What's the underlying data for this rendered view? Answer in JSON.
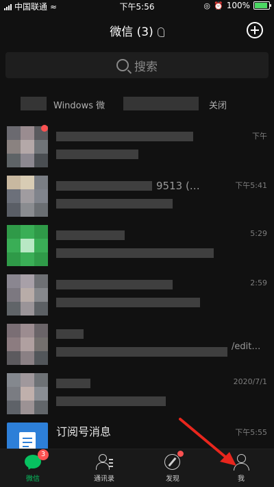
{
  "status_bar": {
    "carrier": "中国联通",
    "time": "下午5:56",
    "battery": "100%"
  },
  "nav": {
    "title": "微信 (3)"
  },
  "search": {
    "placeholder": "搜索"
  },
  "notice": {
    "text": "Windows 微",
    "close_label": "关闭"
  },
  "chats": [
    {
      "time": "下午",
      "sub": ""
    },
    {
      "time": "下午5:41",
      "sub": "9513  (…"
    },
    {
      "time": "5:29",
      "sub": ""
    },
    {
      "time": "2:59",
      "sub": ""
    },
    {
      "time": "",
      "sub": "/edit…"
    },
    {
      "time": "2020/7/1",
      "sub": ""
    },
    {
      "time": "下午5:55",
      "name": "订阅号消息"
    }
  ],
  "tabs": [
    {
      "label": "微信",
      "badge": "3"
    },
    {
      "label": "通讯录"
    },
    {
      "label": "发现"
    },
    {
      "label": "我"
    }
  ],
  "colors": {
    "accent": "#07c160",
    "badge": "#fa5151",
    "arrow": "#e8261d"
  },
  "icons": {
    "add": "plus-circle-icon",
    "search": "search-icon",
    "chats": "chat-bubble-icon",
    "contacts": "contacts-icon",
    "discover": "compass-icon",
    "me": "person-icon"
  }
}
